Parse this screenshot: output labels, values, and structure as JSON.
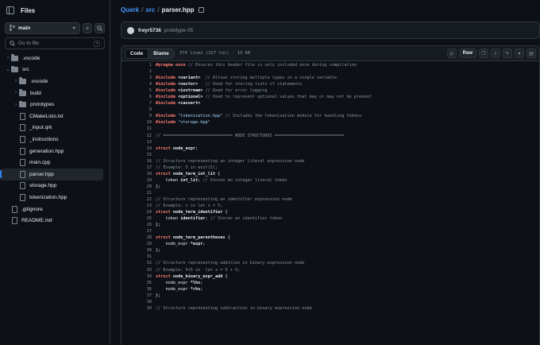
{
  "sidebar": {
    "title": "Files",
    "branch": "main",
    "goto_placeholder": "Go to file",
    "goto_shortcut": "t",
    "tree": [
      {
        "label": ".vscode",
        "type": "folder",
        "depth": 0,
        "expanded": false
      },
      {
        "label": "src",
        "type": "folder",
        "depth": 0,
        "expanded": true
      },
      {
        "label": ".vscode",
        "type": "folder",
        "depth": 1,
        "expanded": false
      },
      {
        "label": "build",
        "type": "folder",
        "depth": 1,
        "expanded": false
      },
      {
        "label": "prototypes",
        "type": "folder",
        "depth": 1,
        "expanded": false
      },
      {
        "label": "CMakeLists.txt",
        "type": "file",
        "depth": 1
      },
      {
        "label": "_input.qrk",
        "type": "file",
        "depth": 1
      },
      {
        "label": "_instructions",
        "type": "file",
        "depth": 1
      },
      {
        "label": "generation.hpp",
        "type": "file",
        "depth": 1
      },
      {
        "label": "main.cpp",
        "type": "file",
        "depth": 1
      },
      {
        "label": "parser.hpp",
        "type": "file",
        "depth": 1,
        "active": true
      },
      {
        "label": "storage.hpp",
        "type": "file",
        "depth": 1
      },
      {
        "label": "tokenization.hpp",
        "type": "file",
        "depth": 1
      },
      {
        "label": ".gitignore",
        "type": "file",
        "depth": 0
      },
      {
        "label": "README.md",
        "type": "file",
        "depth": 0
      }
    ]
  },
  "breadcrumb": {
    "repo": "Querk",
    "sep1": "/",
    "dir": "src",
    "sep2": "/",
    "file": "parser.hpp"
  },
  "commit": {
    "author": "freyr5736",
    "message": "prototype 05"
  },
  "file_toolbar": {
    "code_tab": "Code",
    "blame_tab": "Blame",
    "info": "374 lines (327 loc) · 13 KB",
    "raw_label": "Raw"
  },
  "code_lines": [
    [
      {
        "t": "#pragma once",
        "c": "kw"
      },
      {
        "t": " // Ensures this header file is only included once during compilation",
        "c": "cm"
      }
    ],
    [],
    [
      {
        "t": "#include ",
        "c": "kw"
      },
      {
        "t": "<variant>",
        "c": "bd"
      },
      {
        "t": "  // Allows storing multiple types in a single variable",
        "c": "cm"
      }
    ],
    [
      {
        "t": "#include ",
        "c": "kw"
      },
      {
        "t": "<vector>",
        "c": "bd"
      },
      {
        "t": "   // Used for storing lists of statements",
        "c": "cm"
      }
    ],
    [
      {
        "t": "#include ",
        "c": "kw"
      },
      {
        "t": "<iostream>",
        "c": "bd"
      },
      {
        "t": " // Used for error logging",
        "c": "cm"
      }
    ],
    [
      {
        "t": "#include ",
        "c": "kw"
      },
      {
        "t": "<optional>",
        "c": "bd"
      },
      {
        "t": " // Used to represent optional values that may or may not be present",
        "c": "cm"
      }
    ],
    [
      {
        "t": "#include ",
        "c": "kw"
      },
      {
        "t": "<cassert>",
        "c": "bd"
      }
    ],
    [],
    [
      {
        "t": "#include ",
        "c": "kw"
      },
      {
        "t": "\"tokenization.hpp\"",
        "c": "str"
      },
      {
        "t": " // Includes the tokenization module for handling tokens",
        "c": "cm"
      }
    ],
    [
      {
        "t": "#include ",
        "c": "kw"
      },
      {
        "t": "\"storage.hpp\"",
        "c": "str"
      }
    ],
    [],
    [
      {
        "t": "// ============================ NODE STRUCTURES ============================",
        "c": "cm"
      }
    ],
    [],
    [
      {
        "t": "struct ",
        "c": "kw"
      },
      {
        "t": "node_expr",
        "c": "bd"
      },
      {
        "t": ";",
        "c": ""
      }
    ],
    [],
    [
      {
        "t": "// Structure representing an integer literal expression node",
        "c": "cm"
      }
    ],
    [
      {
        "t": "// Example: 5 in exit(5);",
        "c": "cm"
      }
    ],
    [
      {
        "t": "struct ",
        "c": "kw"
      },
      {
        "t": "node_term_int_lit",
        "c": "bd"
      },
      {
        "t": " {",
        "c": ""
      }
    ],
    [
      {
        "t": "    token ",
        "c": ""
      },
      {
        "t": "int_lit",
        "c": "bd"
      },
      {
        "t": "; ",
        "c": ""
      },
      {
        "t": "// Stores an integer literal token",
        "c": "cm"
      }
    ],
    [
      {
        "t": "};",
        "c": ""
      }
    ],
    [],
    [
      {
        "t": "// Structure representing an identifier expression node",
        "c": "cm"
      }
    ],
    [
      {
        "t": "// Example: x in let x = 5;",
        "c": "cm"
      }
    ],
    [
      {
        "t": "struct ",
        "c": "kw"
      },
      {
        "t": "node_term_identifier",
        "c": "bd"
      },
      {
        "t": " {",
        "c": ""
      }
    ],
    [
      {
        "t": "    token ",
        "c": ""
      },
      {
        "t": "identifier",
        "c": "bd"
      },
      {
        "t": "; ",
        "c": ""
      },
      {
        "t": "// Stores an identifier token",
        "c": "cm"
      }
    ],
    [
      {
        "t": "};",
        "c": ""
      }
    ],
    [],
    [
      {
        "t": "struct ",
        "c": "kw"
      },
      {
        "t": "node_term_parentheses",
        "c": "bd"
      },
      {
        "t": " {",
        "c": ""
      }
    ],
    [
      {
        "t": "    node_expr ",
        "c": ""
      },
      {
        "t": "*expr",
        "c": "bd"
      },
      {
        "t": ";",
        "c": ""
      }
    ],
    [
      {
        "t": "};",
        "c": ""
      }
    ],
    [],
    [
      {
        "t": "// Structure representing addition in binary expression node",
        "c": "cm"
      }
    ],
    [
      {
        "t": "// Example: 5+5 in  let x = 5 + 5;",
        "c": "cm"
      }
    ],
    [
      {
        "t": "struct ",
        "c": "kw"
      },
      {
        "t": "node_binary_expr_add",
        "c": "bd"
      },
      {
        "t": " {",
        "c": ""
      }
    ],
    [
      {
        "t": "    node_expr ",
        "c": ""
      },
      {
        "t": "*lhs",
        "c": "bd"
      },
      {
        "t": ";",
        "c": ""
      }
    ],
    [
      {
        "t": "    node_expr ",
        "c": ""
      },
      {
        "t": "*rhs",
        "c": "bd"
      },
      {
        "t": ";",
        "c": ""
      }
    ],
    [
      {
        "t": "};",
        "c": ""
      }
    ],
    [],
    [
      {
        "t": "// Structure representing subtraction in binary expression node",
        "c": "cm"
      }
    ]
  ],
  "icons": {
    "files": "sidebar-toggle-icon",
    "branch": "git-branch-icon",
    "plus": "plus-icon",
    "search": "search-icon",
    "copy": "copy-icon"
  }
}
